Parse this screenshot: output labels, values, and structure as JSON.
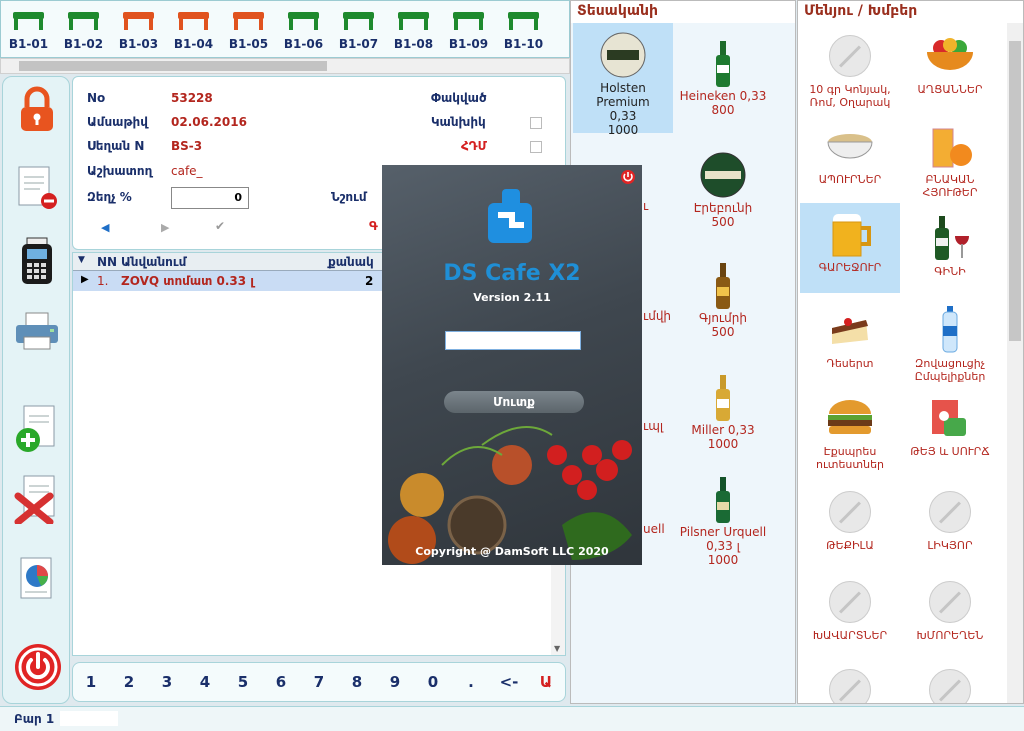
{
  "tables": [
    {
      "label": "B1-01",
      "color": "#1e8a2e"
    },
    {
      "label": "B1-02",
      "color": "#1e8a2e"
    },
    {
      "label": "B1-03",
      "color": "#e0531f"
    },
    {
      "label": "B1-04",
      "color": "#e0531f"
    },
    {
      "label": "B1-05",
      "color": "#e0531f"
    },
    {
      "label": "B1-06",
      "color": "#1e8a2e"
    },
    {
      "label": "B1-07",
      "color": "#1e8a2e"
    },
    {
      "label": "B1-08",
      "color": "#1e8a2e"
    },
    {
      "label": "B1-09",
      "color": "#1e8a2e"
    },
    {
      "label": "B1-10",
      "color": "#1e8a2e"
    }
  ],
  "order": {
    "no_label": "No",
    "no_value": "53228",
    "date_label": "Ամսաթիվ",
    "date_value": "02.06.2016",
    "table_label": "Սեղան N",
    "table_value": "BS-3",
    "worker_label": "Աշխատող",
    "worker_value": "cafe_",
    "discount_label": "Զեղչ %",
    "discount_value": "0",
    "closed_label": "Փակված",
    "cash_label": "Կանխիկ",
    "hdm_label": "ՀԴՄ",
    "note_label": "Նշում",
    "extra_label": "Գ"
  },
  "grid": {
    "headers": [
      "NN",
      "Անվանում",
      "քանակ"
    ],
    "rows": [
      {
        "nn": "1.",
        "name": "ZOVQ տոմատ 0.33 լ",
        "qty": "2"
      }
    ]
  },
  "keypad": [
    "1",
    "2",
    "3",
    "4",
    "5",
    "6",
    "7",
    "8",
    "9",
    "0",
    ".",
    "<-",
    "Ա"
  ],
  "status": {
    "label": "Բար 1"
  },
  "products": {
    "header": "Տեսականի",
    "items": [
      {
        "name": "Holsten Premium",
        "vol": "0,33",
        "price": "1000"
      },
      {
        "name": "Heineken 0,33",
        "vol": "",
        "price": "800"
      },
      {
        "name": "Էրեբունի",
        "vol": "",
        "price": "500"
      },
      {
        "name": "Գյումրի",
        "vol": "",
        "price": "500"
      },
      {
        "name": "Miller  0,33",
        "vol": "",
        "price": "1000"
      },
      {
        "name": "Pilsner Urquell",
        "vol": "0,33 լ",
        "price": "1000"
      }
    ],
    "partial": [
      "ւ",
      "ւմվի",
      "ւպլ",
      "uell"
    ]
  },
  "menu": {
    "header": "Մենյու / Խմբեր",
    "items": [
      "10 գր Կոնյակ, Ռոմ, Օղարակ",
      "ԱՂՑԱՆՆԵՐ",
      "ԱՊՈՒՐՆԵՐ",
      "ԲՆԱԿԱՆ ՀՅՈՒԹԵՐ",
      "ԳԱՐԵՋՈՒՐ",
      "ԳԻՆԻ",
      "Դեսերտ",
      "Զովացուցիչ Ըմպելիքներ",
      "Էքսպրես ուտեստներ",
      "ԹԵՅ և ՍՈՒՐՃ",
      "ԹԵՔԻԼԱ",
      "ԼԻԿՅՈՐ",
      "ԽԱՎԱՐՏՆԵՐ",
      "ԽՄՈՐԵՂԵՆ"
    ]
  },
  "login": {
    "title": "DS Cafe X2",
    "version": "Version 2.11",
    "password_value": "",
    "button": "Մուտք",
    "copyright": "Copyright @ DamSoft LLC 2020"
  }
}
